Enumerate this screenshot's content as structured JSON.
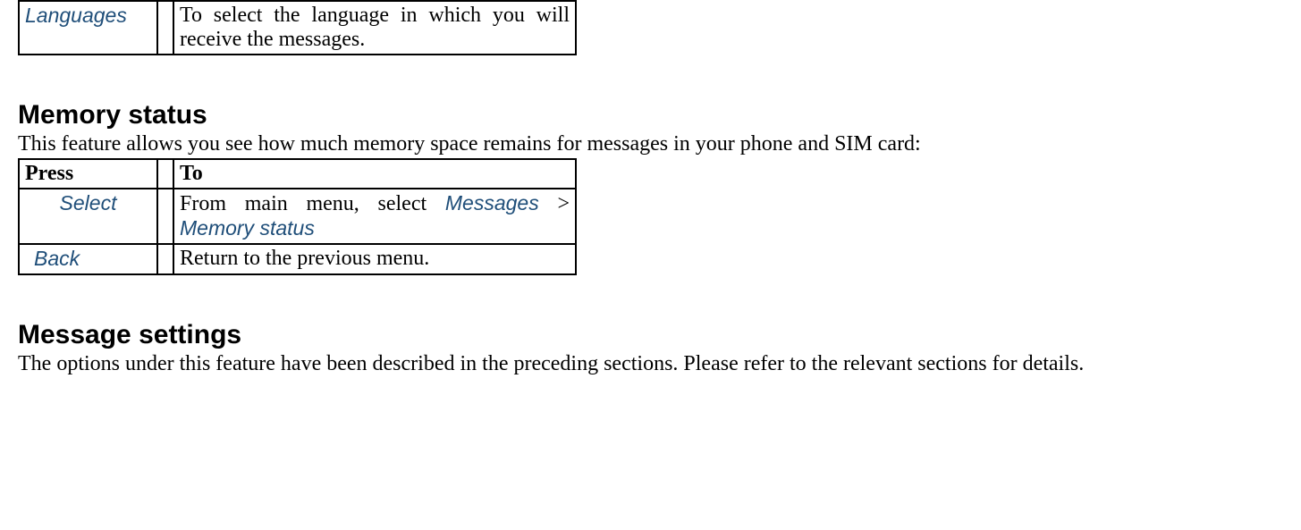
{
  "top_table": {
    "row1": {
      "label": "Languages",
      "desc": "To select the language in which you will receive the messages."
    }
  },
  "section_memory": {
    "heading": "Memory status",
    "intro": "This feature allows you see how much memory space remains for messages in your phone and SIM card:",
    "press_header": "Press",
    "to_header": "To",
    "row1": {
      "label": "Select",
      "desc_prefix": "From main menu, select ",
      "menu1": "Messages",
      "separator": " > ",
      "menu2": "Memory status"
    },
    "row2": {
      "label": "Back",
      "desc": "Return to the previous menu."
    }
  },
  "section_settings": {
    "heading": "Message settings",
    "intro": "The options under this feature have been described in the preceding sections. Please refer to the relevant sections for details."
  }
}
